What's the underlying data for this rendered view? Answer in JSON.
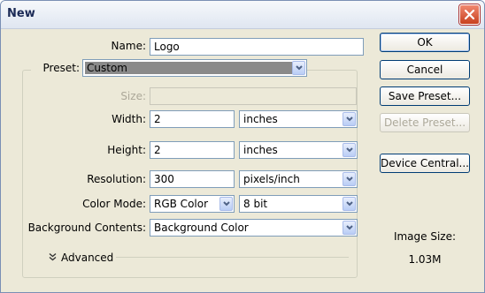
{
  "window": {
    "title": "New",
    "close_icon": "close-icon"
  },
  "form": {
    "name_label": "Name:",
    "name_value": "Logo",
    "preset_label": "Preset:",
    "preset_value": "Custom",
    "size_label": "Size:",
    "size_value": "",
    "width_label": "Width:",
    "width_value": "2",
    "width_unit": "inches",
    "height_label": "Height:",
    "height_value": "2",
    "height_unit": "inches",
    "resolution_label": "Resolution:",
    "resolution_value": "300",
    "resolution_unit": "pixels/inch",
    "color_mode_label": "Color Mode:",
    "color_mode_value": "RGB Color",
    "bit_depth_value": "8 bit",
    "background_label": "Background Contents:",
    "background_value": "Background Color",
    "advanced_label": "Advanced"
  },
  "buttons": {
    "ok": "OK",
    "cancel": "Cancel",
    "save_preset": "Save Preset...",
    "delete_preset": "Delete Preset...",
    "device_central": "Device Central..."
  },
  "image_size": {
    "label": "Image Size:",
    "value": "1.03M"
  }
}
